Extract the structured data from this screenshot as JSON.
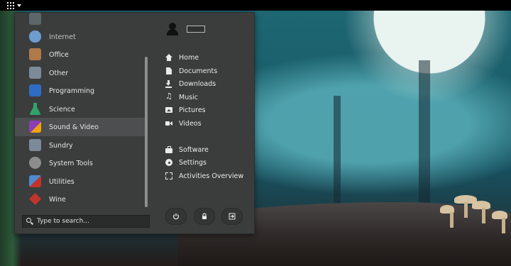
{
  "topbar": {
    "apps_icon": "apps-grid-icon"
  },
  "menu": {
    "categories": [
      {
        "label": "",
        "icon": "partial-item-icon",
        "color": "#7a8a8f"
      },
      {
        "label": "Internet",
        "icon": "cloud-icon",
        "color": "#6f9ccf"
      },
      {
        "label": "Office",
        "icon": "office-icon",
        "color": "#b07a4a"
      },
      {
        "label": "Other",
        "icon": "gear-icon",
        "color": "#7c8a99"
      },
      {
        "label": "Programming",
        "icon": "programming-icon",
        "color": "#2f6cc4"
      },
      {
        "label": "Science",
        "icon": "flask-icon",
        "color": "#2fa36a"
      },
      {
        "label": "Sound & Video",
        "icon": "music-video-icon",
        "color": "#8b3fb5"
      },
      {
        "label": "Sundry",
        "icon": "gear-icon",
        "color": "#7c8a99"
      },
      {
        "label": "System Tools",
        "icon": "gear-icon",
        "color": "#8d8d8d"
      },
      {
        "label": "Utilities",
        "icon": "utilities-icon",
        "color": "#4c8bcf"
      },
      {
        "label": "Wine",
        "icon": "wine-icon",
        "color": "#c0342b"
      }
    ],
    "selected_index": 6,
    "search": {
      "placeholder": "Type to search..."
    },
    "places": [
      {
        "label": "Home",
        "icon": "home-icon"
      },
      {
        "label": "Documents",
        "icon": "document-icon"
      },
      {
        "label": "Downloads",
        "icon": "download-icon"
      },
      {
        "label": "Music",
        "icon": "music-icon"
      },
      {
        "label": "Pictures",
        "icon": "picture-icon"
      },
      {
        "label": "Videos",
        "icon": "video-icon"
      }
    ],
    "system": [
      {
        "label": "Software",
        "icon": "software-icon"
      },
      {
        "label": "Settings",
        "icon": "settings-icon"
      },
      {
        "label": "Activities Overview",
        "icon": "activities-icon"
      }
    ],
    "session_buttons": [
      {
        "name": "power-button",
        "icon": "power-icon"
      },
      {
        "name": "lock-button",
        "icon": "lock-icon"
      },
      {
        "name": "logout-button",
        "icon": "logout-icon"
      }
    ]
  }
}
